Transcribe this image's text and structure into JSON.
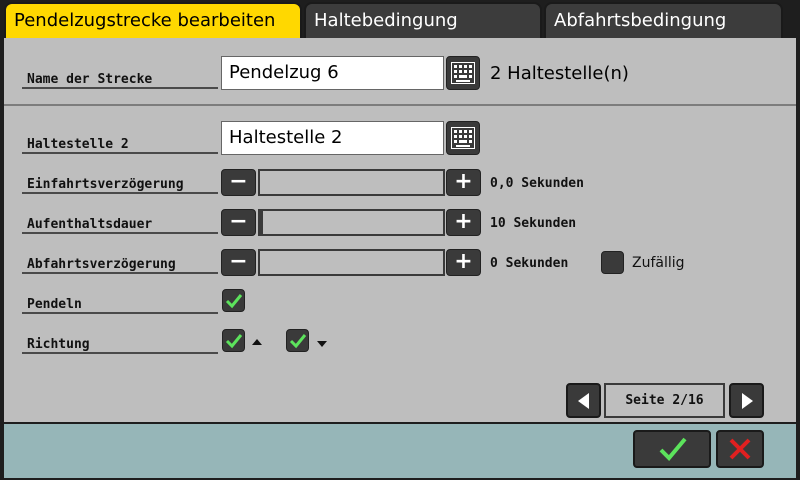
{
  "tabs": [
    {
      "label": "Pendelzugstrecke bearbeiten",
      "active": true
    },
    {
      "label": "Haltebedingung",
      "active": false
    },
    {
      "label": "Abfahrtsbedingung",
      "active": false
    }
  ],
  "route": {
    "name_label": "Name der Strecke",
    "name_value": "Pendelzug 6",
    "stop_count_text": "2 Haltestelle(n)"
  },
  "stop": {
    "label": "Haltestelle 2",
    "value": "Haltestelle 2"
  },
  "sliders": [
    {
      "label": "Einfahrtsverzögerung",
      "value_text": "0,0 Sekunden",
      "fill": 0.0
    },
    {
      "label": "Aufenthaltsdauer",
      "value_text": "10 Sekunden",
      "fill": 0.01
    },
    {
      "label": "Abfahrtsverzögerung",
      "value_text": "0 Sekunden",
      "fill": 0.0
    }
  ],
  "random": {
    "label": "Zufällig",
    "checked": false
  },
  "pendeln": {
    "label": "Pendeln",
    "checked": true
  },
  "richtung": {
    "label": "Richtung",
    "up_checked": true,
    "down_checked": true
  },
  "pagination": {
    "text": "Seite 2/16"
  },
  "colors": {
    "active_tab": "#ffd800",
    "panel": "#bebebe",
    "footer": "#96b6b8",
    "check_green": "#5ce35c",
    "cancel_red": "#e02020"
  },
  "icons": {
    "keyboard": "keyboard-icon",
    "minus": "minus-icon",
    "plus": "plus-icon",
    "check": "checkmark-icon",
    "prev": "arrow-left-icon",
    "next": "arrow-right-icon",
    "ok": "confirm-check-icon",
    "cancel": "cancel-x-icon"
  }
}
